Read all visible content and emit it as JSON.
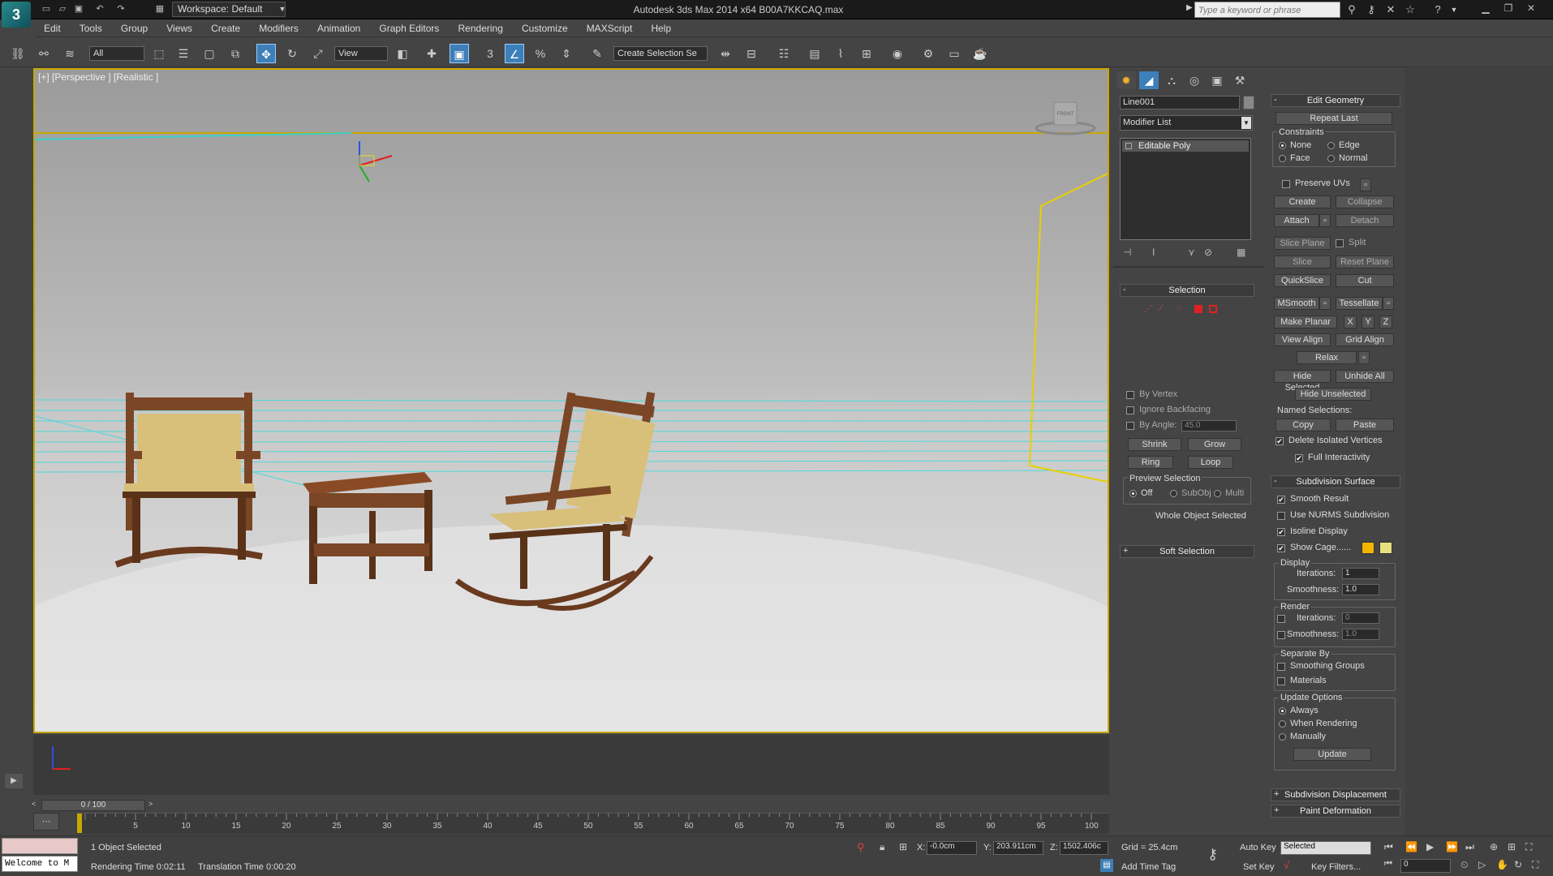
{
  "app": {
    "logo": "3",
    "title": "Autodesk 3ds Max  2014 x64     B00A7KKCAQ.max",
    "workspace": "Workspace: Default",
    "search_placeholder": "Type a keyword or phrase"
  },
  "menu": [
    "Edit",
    "Tools",
    "Group",
    "Views",
    "Create",
    "Modifiers",
    "Animation",
    "Graph Editors",
    "Rendering",
    "Customize",
    "MAXScript",
    "Help"
  ],
  "toolbar": {
    "filter": "All",
    "ref_coord": "View",
    "named_sel": "Create Selection Se"
  },
  "viewport": {
    "label": "[+] [Perspective ] [Realistic ]",
    "viewcube_label": "FRONT"
  },
  "command_panel": {
    "tabs": [
      "create-icon",
      "modify-icon",
      "hierarchy-icon",
      "motion-icon",
      "display-icon",
      "utilities-icon"
    ],
    "object_name": "Line001",
    "modifier_list": "Modifier List",
    "stack": [
      "Editable Poly"
    ],
    "selection": {
      "header": "Selection",
      "by_vertex": "By Vertex",
      "ignore_backfacing": "Ignore Backfacing",
      "by_angle": "By Angle:",
      "angle_value": "45.0",
      "shrink": "Shrink",
      "grow": "Grow",
      "ring": "Ring",
      "loop": "Loop",
      "preview_title": "Preview Selection",
      "preview_off": "Off",
      "preview_subobj": "SubObj",
      "preview_multi": "Multi",
      "status": "Whole Object Selected"
    },
    "soft_selection": "Soft Selection"
  },
  "edit_geometry": {
    "header": "Edit Geometry",
    "repeat_last": "Repeat Last",
    "constraints": "Constraints",
    "c_none": "None",
    "c_edge": "Edge",
    "c_face": "Face",
    "c_normal": "Normal",
    "preserve_uvs": "Preserve UVs",
    "create": "Create",
    "collapse": "Collapse",
    "attach": "Attach",
    "detach": "Detach",
    "slice_plane": "Slice Plane",
    "split": "Split",
    "slice": "Slice",
    "reset_plane": "Reset Plane",
    "quickslice": "QuickSlice",
    "cut": "Cut",
    "msmooth": "MSmooth",
    "tessellate": "Tessellate",
    "make_planar": "Make Planar",
    "x": "X",
    "y": "Y",
    "z": "Z",
    "view_align": "View Align",
    "grid_align": "Grid Align",
    "relax": "Relax",
    "hide_selected": "Hide Selected",
    "unhide_all": "Unhide All",
    "hide_unselected": "Hide Unselected",
    "named_selections": "Named Selections:",
    "copy": "Copy",
    "paste": "Paste",
    "delete_isolated": "Delete Isolated Vertices",
    "full_interactivity": "Full Interactivity"
  },
  "subdivision": {
    "header": "Subdivision Surface",
    "smooth_result": "Smooth Result",
    "use_nurms": "Use NURMS Subdivision",
    "isoline": "Isoline Display",
    "show_cage": "Show Cage......",
    "cage_color_1": "#f2b600",
    "cage_color_2": "#e8e080",
    "display": "Display",
    "iterations": "Iterations:",
    "iterations_val": "1",
    "smoothness": "Smoothness:",
    "smoothness_val": "1.0",
    "render": "Render",
    "r_iterations_val": "0",
    "r_smoothness_val": "1.0",
    "separate_by": "Separate By",
    "smoothing_groups": "Smoothing Groups",
    "materials": "Materials",
    "update_options": "Update Options",
    "always": "Always",
    "when_rendering": "When Rendering",
    "manually": "Manually",
    "update": "Update"
  },
  "extra_rollouts": [
    "Subdivision Displacement",
    "Paint Deformation"
  ],
  "timeline": {
    "frame": "0 / 100",
    "ticks": [
      "5",
      "10",
      "15",
      "20",
      "25",
      "30",
      "35",
      "40",
      "45",
      "50",
      "55",
      "60",
      "65",
      "70",
      "75",
      "80",
      "85",
      "90",
      "95",
      "100"
    ]
  },
  "status": {
    "maxscript": "Welcome to M",
    "selected": "1 Object Selected",
    "render_time": "Rendering Time  0:02:11",
    "translation_time": "Translation Time  0:00:20",
    "x_label": "X:",
    "x_val": "-0.0cm",
    "y_label": "Y:",
    "y_val": "203.911cm",
    "z_label": "Z:",
    "z_val": "1502.406c",
    "grid": "Grid = 25.4cm",
    "add_time_tag": "Add Time Tag",
    "auto_key": "Auto Key",
    "set_key": "Set Key",
    "key_mode": "Selected",
    "key_filters": "Key Filters...",
    "frame_field": "0"
  }
}
